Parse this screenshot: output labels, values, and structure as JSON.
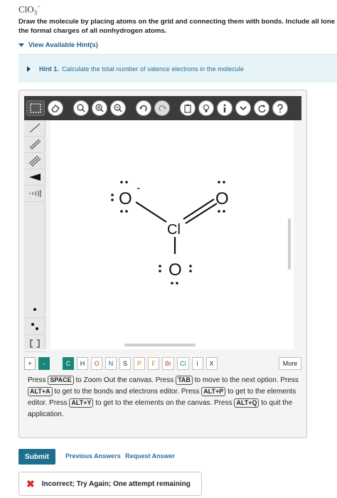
{
  "question": {
    "formula_base": "ClO",
    "formula_sub": "3",
    "formula_sup": "−",
    "prompt_line1": "Draw the molecule by placing atoms on the grid and connecting them with bonds. Include all lone",
    "prompt_line2": "the formal charges of all nonhydrogen atoms."
  },
  "hints": {
    "toggle_label": "View Available Hint(s)",
    "hint_title": "Hint 1.",
    "hint_text": "Calculate the total number of valence electrons in the molecule"
  },
  "toolbar": {
    "icons": [
      "marquee-icon",
      "eraser-icon",
      "zoom-fit-icon",
      "zoom-in-icon",
      "zoom-out-icon",
      "undo-icon",
      "redo-icon",
      "paste-icon",
      "bulb-icon",
      "info-icon",
      "chevron-down-icon",
      "refresh-icon",
      "help-icon"
    ]
  },
  "molecule": {
    "atoms": [
      {
        "symbol": "O",
        "charge": "-"
      },
      {
        "symbol": "O",
        "charge": ""
      },
      {
        "symbol": "Cl",
        "charge": ""
      },
      {
        "symbol": "O",
        "charge": ""
      }
    ]
  },
  "palette": {
    "items": [
      "+",
      "-",
      "C",
      "H",
      "O",
      "N",
      "S",
      "P",
      "F",
      "Br",
      "Cl",
      "I",
      "X"
    ],
    "more": "More"
  },
  "instructions": {
    "p1": "Press",
    "k1": "SPACE",
    "t1": "to Zoom Out the canvas. Press",
    "k2": "TAB",
    "t2": "to move to the next option. Press",
    "k3": "ALT+A",
    "t3": "to get to the bonds and electrons editor. Press",
    "k4": "ALT+P",
    "t4": "to get to the elements editor. Press",
    "k5": "ALT+Y",
    "t5": "to get to the elements on the canvas. Press",
    "k6": "ALT+Q",
    "t6": "to quit the application."
  },
  "actions": {
    "submit": "Submit",
    "previous_answers": "Previous Answers",
    "request_answer": "Request Answer"
  },
  "feedback": {
    "text": "Incorrect; Try Again; One attempt remaining"
  },
  "colors": {
    "accent": "#1f6e8c",
    "teal": "#17877a",
    "link": "#2f6ea3",
    "error": "#d22f27"
  }
}
